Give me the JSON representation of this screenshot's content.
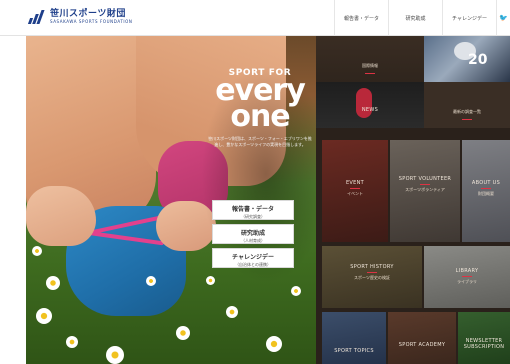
{
  "header": {
    "logo_jp": "笹川スポーツ財団",
    "logo_en": "SASAKAWA SPORTS FOUNDATION",
    "nav": [
      {
        "label": "報告書・データ"
      },
      {
        "label": "研究助成"
      },
      {
        "label": "チャレンジデー"
      },
      {
        "label": "🐦"
      }
    ]
  },
  "hero": {
    "tag_small": "SPORT FOR",
    "tag_every": "every",
    "tag_one": "one",
    "description": "笹川スポーツ財団は、スポーツ・フォー・エブリワンを推進し、豊かなスポーツライフの実現を目指します。",
    "buttons": [
      {
        "main": "報告書・データ",
        "sub": "（研究調査）"
      },
      {
        "main": "研究助成",
        "sub": "（人材育成）"
      },
      {
        "main": "チャレンジデー",
        "sub": "（自治体との連携）"
      }
    ]
  },
  "tiles": {
    "intl": {
      "en": "",
      "jp": "国際情報"
    },
    "news": {
      "en": "NEWS",
      "jp": ""
    },
    "recent": {
      "en": "",
      "jp": "最新の調査一覧"
    },
    "event": {
      "en": "EVENT",
      "jp": "イベント"
    },
    "volunteer": {
      "en": "SPORT VOLUNTEER",
      "jp": "スポーツボランティア"
    },
    "about": {
      "en": "ABOUT US",
      "jp": "財団概要"
    },
    "history": {
      "en": "SPORT HISTORY",
      "jp": "スポーツ歴史の検証"
    },
    "library": {
      "en": "LIBRARY",
      "jp": "ライブラリ"
    },
    "topics": {
      "en": "SPORT TOPICS",
      "jp": ""
    },
    "academy": {
      "en": "SPORT ACADEMY",
      "jp": ""
    },
    "newsletter": {
      "en": "NEWSLETTER SUBSCRIPTION",
      "jp": ""
    },
    "football_number": "20"
  }
}
